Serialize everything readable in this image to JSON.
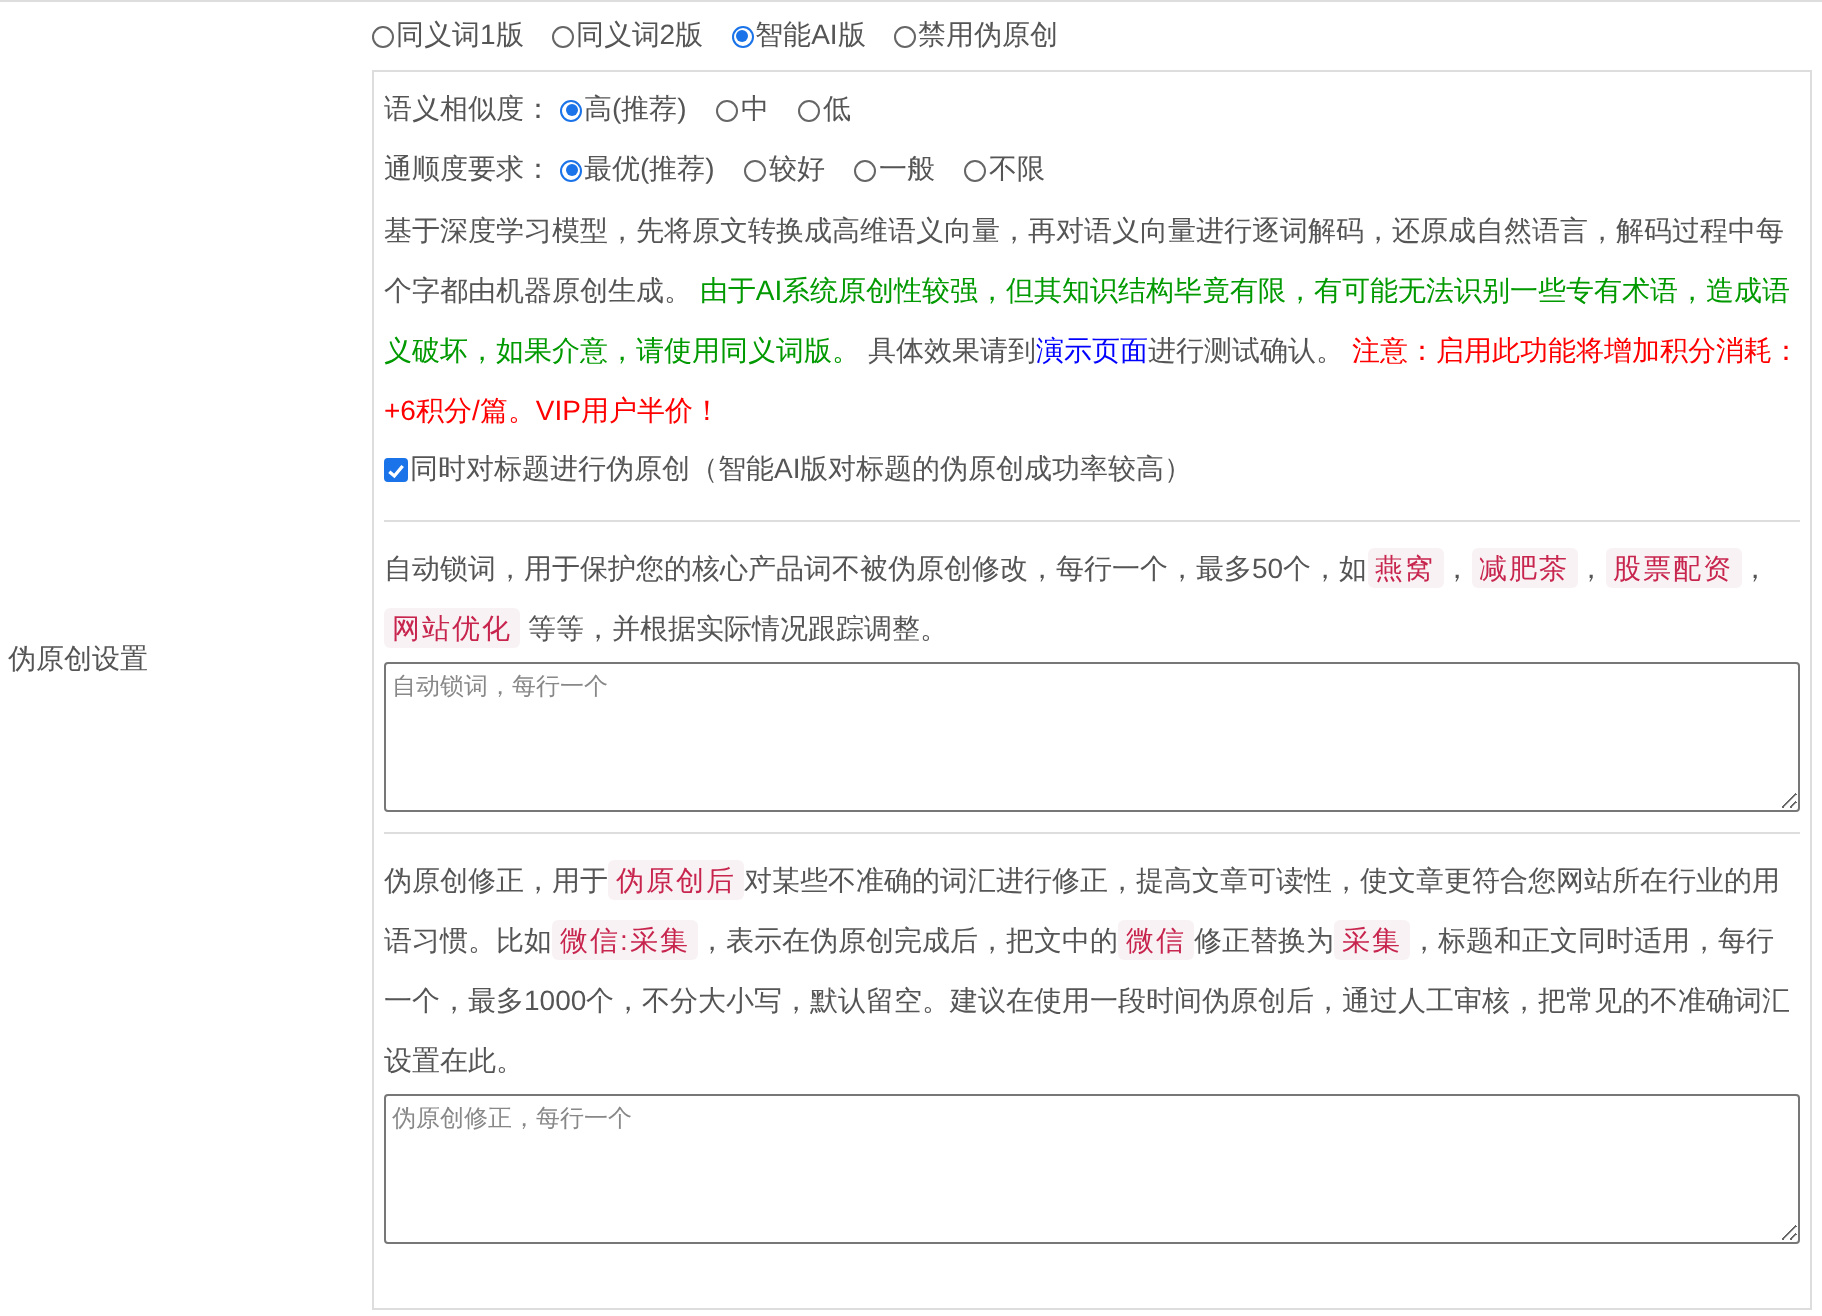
{
  "setting_label": "伪原创设置",
  "modes": [
    {
      "label": "同义词1版",
      "selected": false
    },
    {
      "label": "同义词2版",
      "selected": false
    },
    {
      "label": "智能AI版",
      "selected": true
    },
    {
      "label": "禁用伪原创",
      "selected": false
    }
  ],
  "similarity": {
    "label": "语义相似度：",
    "options": [
      {
        "label": "高(推荐)",
        "selected": true
      },
      {
        "label": "中",
        "selected": false
      },
      {
        "label": "低",
        "selected": false
      }
    ]
  },
  "fluency": {
    "label": "通顺度要求：",
    "options": [
      {
        "label": "最优(推荐)",
        "selected": true
      },
      {
        "label": "较好",
        "selected": false
      },
      {
        "label": "一般",
        "selected": false
      },
      {
        "label": "不限",
        "selected": false
      }
    ]
  },
  "description": [
    {
      "kind": "text",
      "text": "基于深度学习模型，先将原文转换成高维语义向量，再对语义向量进行逐词解码，还原成自然语言，解码过程中每个字都由机器原创生成。 "
    },
    {
      "kind": "success",
      "text": "由于AI系统原创性较强，但其知识结构毕竟有限，有可能无法识别一些专有术语，造成语义破坏，如果介意，请使用同义词版。"
    },
    {
      "kind": "text",
      "text": " 具体效果请到"
    },
    {
      "kind": "link",
      "text": "演示页面"
    },
    {
      "kind": "text",
      "text": "进行测试确认。 "
    },
    {
      "kind": "warning",
      "text": "注意：启用此功能将增加积分消耗：+6积分/篇。VIP用户半价！"
    }
  ],
  "title_option": {
    "label": "同时对标题进行伪原创（智能AI版对标题的伪原创成功率较高）",
    "checked": true
  },
  "lock_words": {
    "description": [
      {
        "kind": "text",
        "text": "自动锁词，用于保护您的核心产品词不被伪原创修改，每行一个，最多50个，如"
      },
      {
        "kind": "tag",
        "text": "燕窝"
      },
      {
        "kind": "text",
        "text": "，"
      },
      {
        "kind": "tag",
        "text": "减肥茶"
      },
      {
        "kind": "text",
        "text": "，"
      },
      {
        "kind": "tag",
        "text": "股票配资"
      },
      {
        "kind": "text",
        "text": "，"
      },
      {
        "kind": "tag",
        "text": "网站优化"
      },
      {
        "kind": "text",
        "text": " 等等，并根据实际情况跟踪调整。"
      }
    ],
    "placeholder": "自动锁词，每行一个"
  },
  "corrections": {
    "description": [
      {
        "kind": "text",
        "text": "伪原创修正，用于"
      },
      {
        "kind": "tag",
        "text": "伪原创后"
      },
      {
        "kind": "text",
        "text": "对某些不准确的词汇进行修正，提高文章可读性，使文章更符合您网站所在行业的用语习惯。比如"
      },
      {
        "kind": "tag",
        "text": "微信:采集"
      },
      {
        "kind": "text",
        "text": "，表示在伪原创完成后，把文中的"
      },
      {
        "kind": "tag",
        "text": "微信"
      },
      {
        "kind": "text",
        "text": "修正替换为"
      },
      {
        "kind": "tag",
        "text": "采集"
      },
      {
        "kind": "text",
        "text": "，标题和正文同时适用，每行一个，最多1000个，不分大小写，默认留空。建议在使用一段时间伪原创后，通过人工审核，把常见的不准确词汇设置在此。"
      }
    ],
    "placeholder": "伪原创修正，每行一个"
  }
}
